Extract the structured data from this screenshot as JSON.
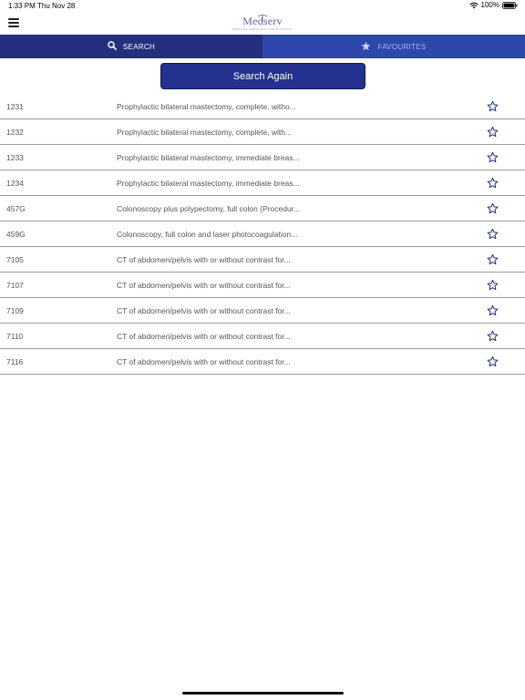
{
  "status_bar": {
    "time": "1:33 PM",
    "date": "Thu Nov 28",
    "battery": "100%"
  },
  "logo": {
    "text": "Medserv",
    "tagline": "MEDICAL SERVICES CONSULTANTS"
  },
  "tabs": [
    {
      "label": "SEARCH",
      "icon": "search-icon",
      "active": true
    },
    {
      "label": "FAVOURITES",
      "icon": "star-icon",
      "active": false
    }
  ],
  "search_again_label": "Search Again",
  "results": [
    {
      "code": "1231",
      "description": "Prophylactic bilateral mastectomy, complete, witho..."
    },
    {
      "code": "1232",
      "description": "Prophylactic bilateral mastectomy, complete, with..."
    },
    {
      "code": "1233",
      "description": "Prophylactic bilateral mastectomy, immediate breas..."
    },
    {
      "code": "1234",
      "description": "Prophylactic bilateral mastectomy, immediate breas..."
    },
    {
      "code": "457G",
      "description": "Colonoscopy plus polypectomy, full colon (Procedur..."
    },
    {
      "code": "459G",
      "description": "Colonoscopy, full colon and laser photocoagulation..."
    },
    {
      "code": "7105",
      "description": "CT of abdomen/pelvis with or without contrast for..."
    },
    {
      "code": "7107",
      "description": "CT of abdomen/pelvis with or without contrast for..."
    },
    {
      "code": "7109",
      "description": "CT of abdomen/pelvis with or without contrast for..."
    },
    {
      "code": "7110",
      "description": "CT of abdomen/pelvis with or without contrast for..."
    },
    {
      "code": "7116",
      "description": "CT of abdomen/pelvis with or without contrast for..."
    }
  ],
  "colors": {
    "primary": "#24307e",
    "tab_inactive": "#2e47ad",
    "button": "#24318f",
    "star": "#24307e"
  }
}
